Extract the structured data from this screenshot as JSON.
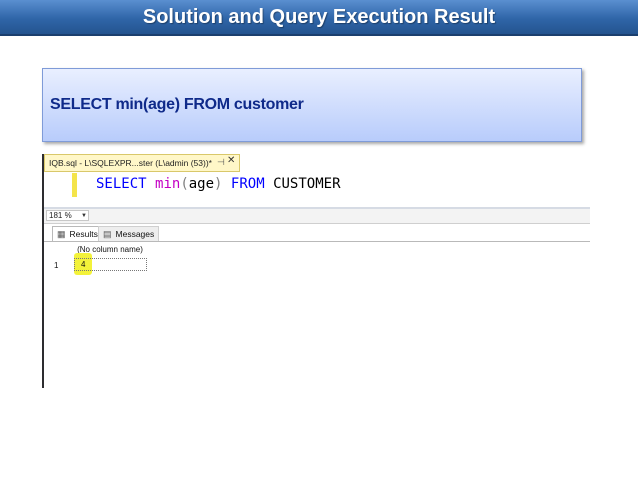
{
  "slide": {
    "title": "Solution and Query Execution Result",
    "query_text": "SELECT min(age) FROM customer"
  },
  "editor": {
    "tab_label": "IQB.sql - L\\SQLEXPR...ster (L\\admin (53))*",
    "pin_icon": "pin-icon",
    "close_icon": "close-icon",
    "code": {
      "kw_select": "SELECT",
      "fn_min": "min",
      "paren_open": "(",
      "arg": "age",
      "paren_close": ")",
      "kw_from": "FROM",
      "table": "CUSTOMER"
    }
  },
  "zoom": {
    "value": "181 %"
  },
  "result_tabs": [
    {
      "label": "Results",
      "icon": "grid-icon"
    },
    {
      "label": "Messages",
      "icon": "message-icon"
    }
  ],
  "grid": {
    "columns": [
      "(No column name)"
    ],
    "rows": [
      {
        "row_number": "1",
        "values": [
          "4"
        ]
      }
    ]
  },
  "colors": {
    "title_bar": "#2f65a8",
    "query_text": "#0f2a8a",
    "highlight": "#f3f23a",
    "sql_keyword": "#0000ff",
    "sql_function": "#c400c4"
  }
}
